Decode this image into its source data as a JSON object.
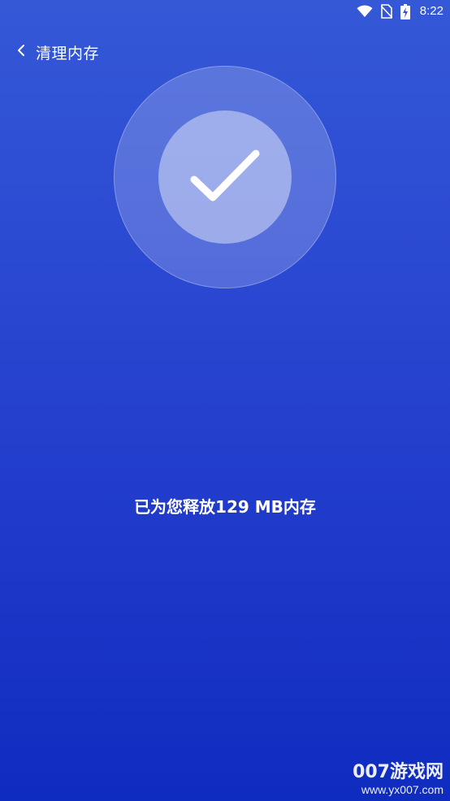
{
  "status_bar": {
    "time": "8:22",
    "icons": [
      "wifi-icon",
      "no-sim-icon",
      "battery-charging-icon"
    ]
  },
  "header": {
    "back_icon": "chevron-left-icon",
    "title": "清理内存"
  },
  "result": {
    "icon": "checkmark-icon",
    "message": "已为您释放129 MB内存"
  },
  "watermark": {
    "brand": "007游戏网",
    "url": "www.yx007.com"
  },
  "colors": {
    "background_top": "#3458d6",
    "background_bottom": "#0f2cc0",
    "text": "#ffffff"
  }
}
